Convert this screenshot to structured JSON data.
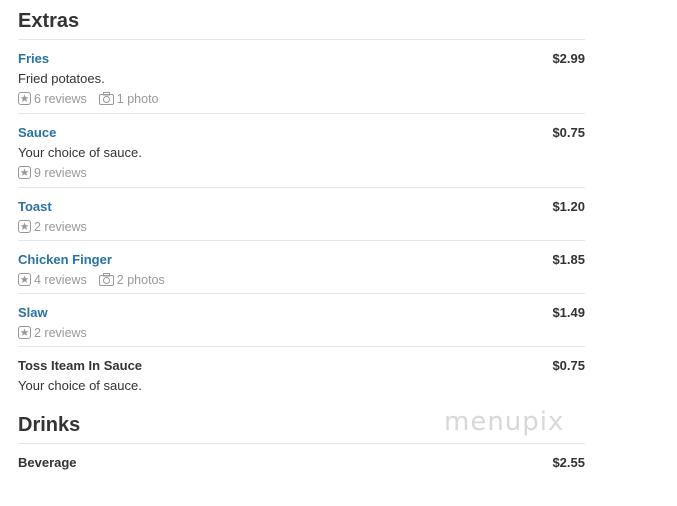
{
  "sections": [
    {
      "title": "Extras",
      "items": [
        {
          "name": "Fries",
          "price": "$2.99",
          "description": "Fried potatoes.",
          "reviews": "6 reviews",
          "photos": "1 photo"
        },
        {
          "name": "Sauce",
          "price": "$0.75",
          "description": "Your choice of sauce.",
          "reviews": "9 reviews"
        },
        {
          "name": "Toast",
          "price": "$1.20",
          "reviews": "2 reviews"
        },
        {
          "name": "Chicken Finger",
          "price": "$1.85",
          "reviews": "4 reviews",
          "photos": "2 photos"
        },
        {
          "name": "Slaw",
          "price": "$1.49",
          "reviews": "2 reviews"
        },
        {
          "name": "Toss Iteam In Sauce",
          "price": "$0.75",
          "description": "Your choice of sauce."
        }
      ]
    },
    {
      "title": "Drinks",
      "items": [
        {
          "name": "Beverage",
          "price": "$2.55"
        }
      ]
    }
  ],
  "watermark": "menupix",
  "colors": {
    "link": "#2873a4",
    "text": "#333333",
    "muted": "#999999",
    "divider": "#e6e6e6"
  },
  "icons": {
    "reviews": "star-badge-icon",
    "photos": "camera-icon"
  }
}
